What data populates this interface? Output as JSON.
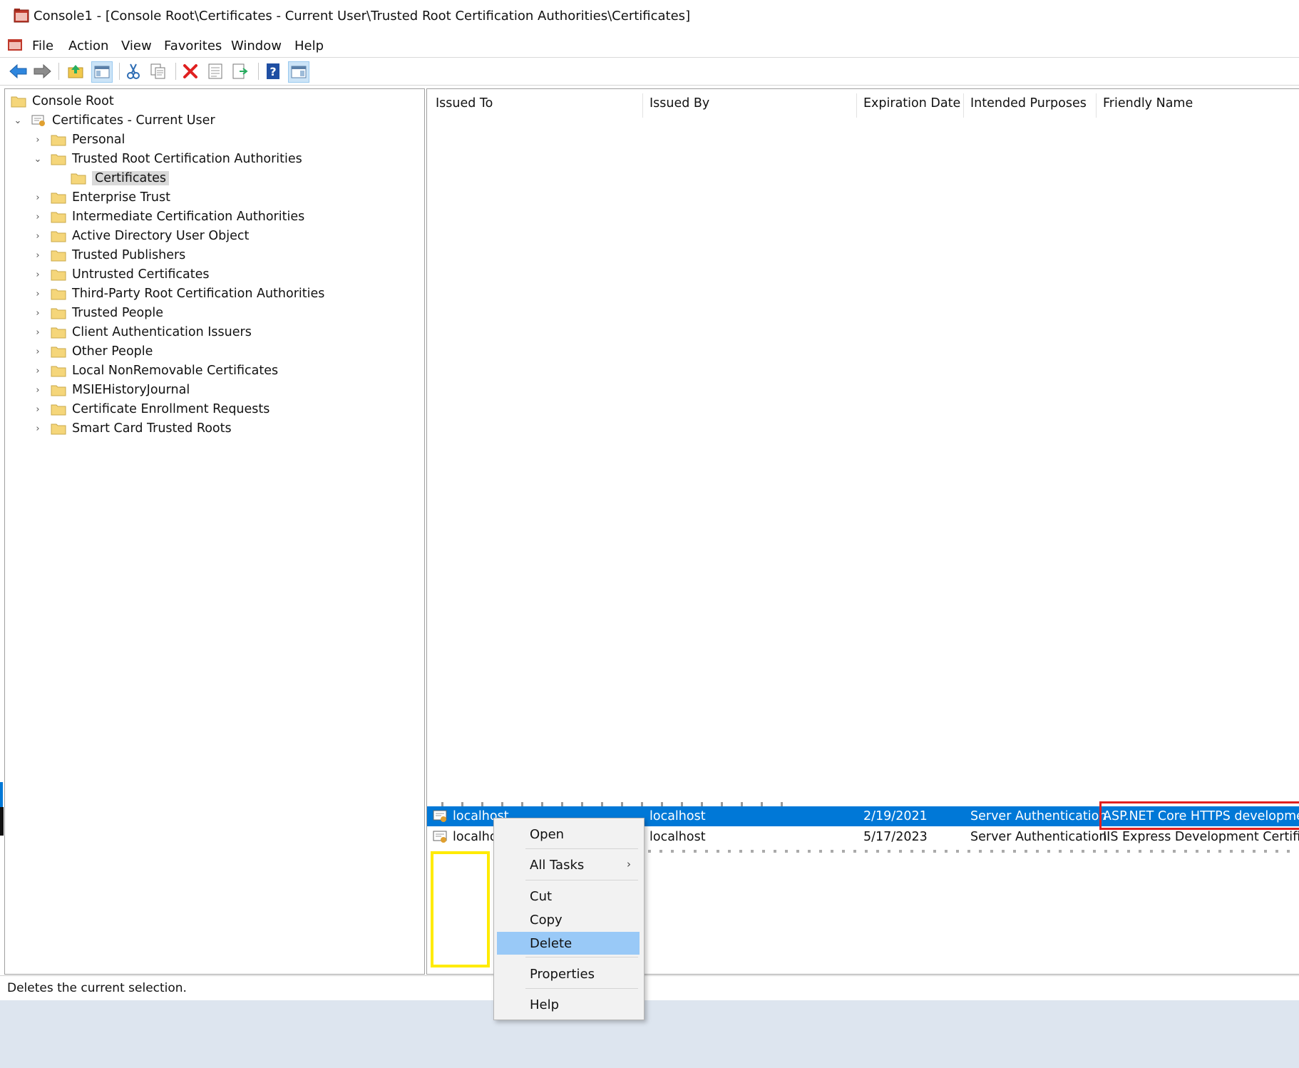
{
  "window": {
    "title": "Console1 - [Console Root\\Certificates - Current User\\Trusted Root Certification Authorities\\Certificates]"
  },
  "menubar": {
    "items": [
      "File",
      "Action",
      "View",
      "Favorites",
      "Window",
      "Help"
    ]
  },
  "toolbar": {
    "buttons": [
      "back-arrow-icon",
      "forward-arrow-icon",
      "up-folder-icon",
      "show-hide-tree-icon",
      "cut-icon",
      "copy-icon",
      "delete-icon",
      "properties-icon",
      "export-icon",
      "help-icon",
      "action-pane-icon"
    ]
  },
  "tree": {
    "root": "Console Root",
    "store": "Certificates - Current User",
    "items": [
      "Personal",
      "Trusted Root Certification Authorities",
      "Certificates",
      "Enterprise Trust",
      "Intermediate Certification Authorities",
      "Active Directory User Object",
      "Trusted Publishers",
      "Untrusted Certificates",
      "Third-Party Root Certification Authorities",
      "Trusted People",
      "Client Authentication Issuers",
      "Other People",
      "Local NonRemovable Certificates",
      "MSIEHistoryJournal",
      "Certificate Enrollment Requests",
      "Smart Card Trusted Roots"
    ]
  },
  "list": {
    "columns": [
      "Issued To",
      "Issued By",
      "Expiration Date",
      "Intended Purposes",
      "Friendly Name"
    ],
    "rows": [
      {
        "issued_to": "localhost",
        "issued_by": "localhost",
        "expiration": "2/19/2021",
        "purposes": "Server Authentication",
        "friendly": "ASP.NET Core HTTPS development c"
      },
      {
        "issued_to": "localho",
        "issued_by": "localhost",
        "expiration": "5/17/2023",
        "purposes": "Server Authentication",
        "friendly": "IIS Express Development Certificate"
      }
    ]
  },
  "context_menu": {
    "open": "Open",
    "all_tasks": "All Tasks",
    "cut": "Cut",
    "copy": "Copy",
    "delete": "Delete",
    "properties": "Properties",
    "help": "Help"
  },
  "status": {
    "text": "Deletes the current selection."
  },
  "colors": {
    "selection": "#0078d7",
    "menu_highlight": "#99c9f7",
    "red_annotation": "#e02020",
    "yellow_annotation": "#ffeb00"
  }
}
